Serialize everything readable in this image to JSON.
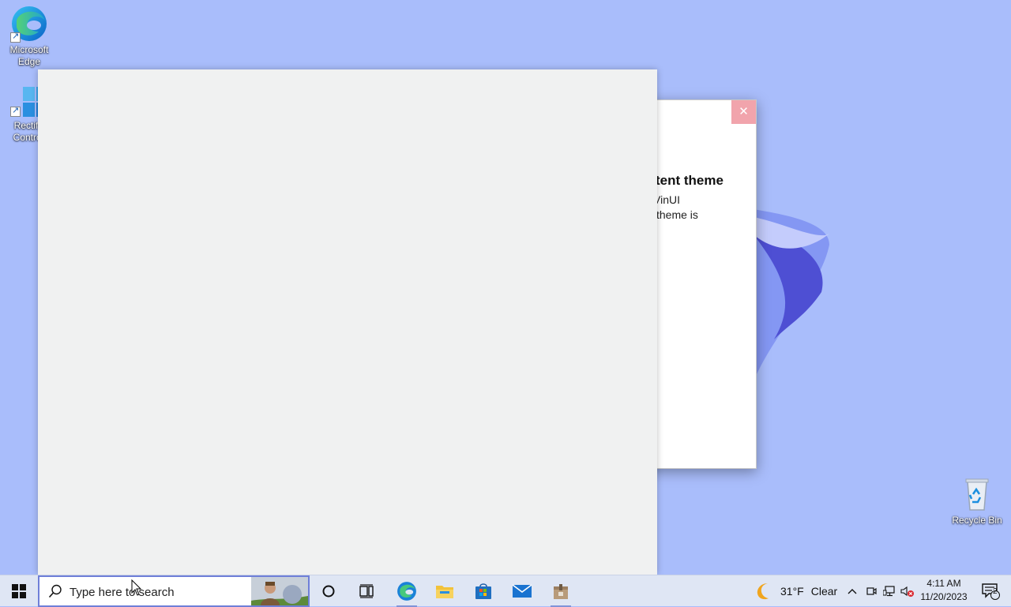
{
  "desktop": {
    "icons": [
      {
        "label": "Microsoft Edge"
      },
      {
        "label": "Rectify Control"
      },
      {
        "label": "Recycle Bin"
      }
    ]
  },
  "dialog": {
    "heading": "tent theme",
    "lines": [
      "VinUI",
      "theme is"
    ],
    "close_glyph": "✕"
  },
  "taskbar": {
    "search_placeholder": "Type here to search",
    "weather": {
      "temperature": "31°F",
      "condition": "Clear",
      "icon": "moon-icon"
    },
    "clock": {
      "time": "4:11 AM",
      "date": "11/20/2023"
    },
    "notification_count": "2",
    "apps": [
      "cortana-icon",
      "task-view-icon",
      "edge-icon",
      "file-explorer-icon",
      "store-icon",
      "mail-icon",
      "app-package-icon"
    ]
  },
  "colors": {
    "desktop_bg": "#a9bdfb",
    "window_bg": "#f0f1f1",
    "taskbar_bg": "#dfe6f4",
    "close_hover": "#f1a4ac"
  }
}
